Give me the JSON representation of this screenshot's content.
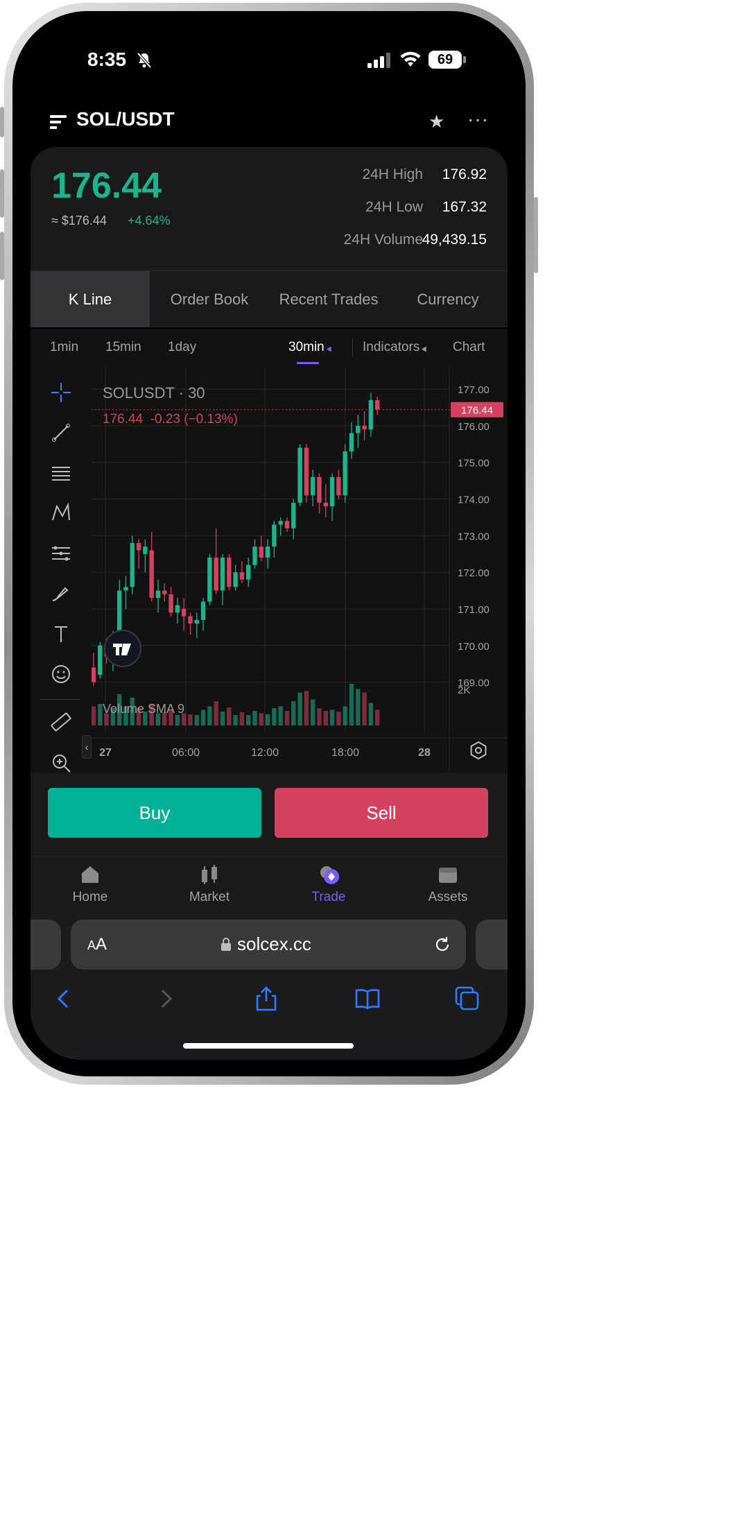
{
  "status_bar": {
    "time": "8:35",
    "battery": "69"
  },
  "header": {
    "pair": "SOL/USDT"
  },
  "ticker": {
    "last_price": "176.44",
    "usd_price": "≈ $176.44",
    "change_pct": "+4.64%",
    "stats": [
      {
        "label": "24H High",
        "value": "176.92"
      },
      {
        "label": "24H Low",
        "value": "167.32"
      },
      {
        "label": "24H Volume",
        "value": "49,439.15"
      }
    ]
  },
  "tabs": [
    "K Line",
    "Order Book",
    "Recent Trades",
    "Currency"
  ],
  "intervals": {
    "options": [
      "1min",
      "15min",
      "1day"
    ],
    "selected": "30min",
    "indicators": "Indicators",
    "chart": "Chart"
  },
  "chart_data": {
    "type": "candlestick",
    "symbol_label": "SOLUSDT · 30",
    "ohlc_label": "176.44  -0.23 (−0.13%)",
    "current_price_tag": "176.44",
    "y_ticks": [
      "177.00",
      "176.00",
      "175.00",
      "174.00",
      "173.00",
      "172.00",
      "171.00",
      "170.00",
      "169.00"
    ],
    "ylim": [
      168.5,
      177.4
    ],
    "x_ticks": [
      "27",
      "06:00",
      "12:00",
      "18:00",
      "28"
    ],
    "volume_label": "Volume SMA 9",
    "volume_tick": "2K",
    "candles": [
      {
        "o": 169.4,
        "h": 169.8,
        "l": 168.9,
        "c": 169.0
      },
      {
        "o": 169.2,
        "h": 170.1,
        "l": 169.1,
        "c": 170.0
      },
      {
        "o": 169.9,
        "h": 170.2,
        "l": 169.5,
        "c": 169.7
      },
      {
        "o": 169.7,
        "h": 170.4,
        "l": 169.3,
        "c": 170.2
      },
      {
        "o": 170.2,
        "h": 171.8,
        "l": 169.7,
        "c": 171.5
      },
      {
        "o": 171.5,
        "h": 171.9,
        "l": 171.0,
        "c": 171.6
      },
      {
        "o": 171.6,
        "h": 173.0,
        "l": 171.4,
        "c": 172.8
      },
      {
        "o": 172.8,
        "h": 172.9,
        "l": 172.1,
        "c": 172.6
      },
      {
        "o": 172.5,
        "h": 172.9,
        "l": 172.0,
        "c": 172.7
      },
      {
        "o": 172.6,
        "h": 173.1,
        "l": 171.2,
        "c": 171.3
      },
      {
        "o": 171.3,
        "h": 171.8,
        "l": 170.9,
        "c": 171.5
      },
      {
        "o": 171.5,
        "h": 171.7,
        "l": 171.2,
        "c": 171.4
      },
      {
        "o": 171.4,
        "h": 171.6,
        "l": 170.8,
        "c": 170.9
      },
      {
        "o": 170.9,
        "h": 171.3,
        "l": 170.6,
        "c": 171.1
      },
      {
        "o": 171.0,
        "h": 171.3,
        "l": 170.4,
        "c": 170.8
      },
      {
        "o": 170.8,
        "h": 170.9,
        "l": 170.3,
        "c": 170.6
      },
      {
        "o": 170.6,
        "h": 170.9,
        "l": 170.2,
        "c": 170.7
      },
      {
        "o": 170.7,
        "h": 171.3,
        "l": 170.4,
        "c": 171.2
      },
      {
        "o": 171.2,
        "h": 172.5,
        "l": 171.1,
        "c": 172.4
      },
      {
        "o": 172.4,
        "h": 173.2,
        "l": 171.4,
        "c": 171.5
      },
      {
        "o": 171.5,
        "h": 172.5,
        "l": 171.1,
        "c": 172.4
      },
      {
        "o": 172.4,
        "h": 172.5,
        "l": 171.5,
        "c": 171.6
      },
      {
        "o": 171.6,
        "h": 172.2,
        "l": 171.5,
        "c": 172.0
      },
      {
        "o": 172.0,
        "h": 172.3,
        "l": 171.7,
        "c": 171.8
      },
      {
        "o": 171.8,
        "h": 172.4,
        "l": 171.6,
        "c": 172.2
      },
      {
        "o": 172.2,
        "h": 172.9,
        "l": 172.1,
        "c": 172.7
      },
      {
        "o": 172.7,
        "h": 173.0,
        "l": 172.3,
        "c": 172.4
      },
      {
        "o": 172.4,
        "h": 172.9,
        "l": 172.1,
        "c": 172.7
      },
      {
        "o": 172.7,
        "h": 173.4,
        "l": 172.4,
        "c": 173.3
      },
      {
        "o": 173.3,
        "h": 173.5,
        "l": 173.0,
        "c": 173.4
      },
      {
        "o": 173.4,
        "h": 173.5,
        "l": 173.1,
        "c": 173.2
      },
      {
        "o": 173.2,
        "h": 174.0,
        "l": 172.9,
        "c": 173.9
      },
      {
        "o": 173.9,
        "h": 175.5,
        "l": 173.8,
        "c": 175.4
      },
      {
        "o": 175.4,
        "h": 175.5,
        "l": 173.9,
        "c": 174.1
      },
      {
        "o": 174.1,
        "h": 174.8,
        "l": 173.8,
        "c": 174.6
      },
      {
        "o": 174.6,
        "h": 174.7,
        "l": 173.6,
        "c": 173.9
      },
      {
        "o": 173.9,
        "h": 174.4,
        "l": 173.5,
        "c": 173.8
      },
      {
        "o": 173.8,
        "h": 174.7,
        "l": 173.4,
        "c": 174.6
      },
      {
        "o": 174.6,
        "h": 174.8,
        "l": 174.0,
        "c": 174.1
      },
      {
        "o": 174.1,
        "h": 175.5,
        "l": 173.9,
        "c": 175.3
      },
      {
        "o": 175.3,
        "h": 176.1,
        "l": 175.1,
        "c": 175.8
      },
      {
        "o": 175.8,
        "h": 176.3,
        "l": 175.4,
        "c": 176.0
      },
      {
        "o": 176.0,
        "h": 176.4,
        "l": 175.6,
        "c": 175.9
      },
      {
        "o": 175.9,
        "h": 176.9,
        "l": 175.7,
        "c": 176.7
      },
      {
        "o": 176.7,
        "h": 176.8,
        "l": 176.3,
        "c": 176.44
      }
    ],
    "volumes": [
      0.55,
      0.62,
      0.35,
      0.5,
      0.9,
      0.55,
      0.8,
      0.5,
      0.4,
      0.62,
      0.35,
      0.38,
      0.42,
      0.3,
      0.35,
      0.32,
      0.3,
      0.45,
      0.55,
      0.7,
      0.4,
      0.52,
      0.3,
      0.38,
      0.3,
      0.42,
      0.35,
      0.32,
      0.5,
      0.55,
      0.42,
      0.7,
      0.95,
      1.0,
      0.75,
      0.5,
      0.42,
      0.45,
      0.4,
      0.55,
      1.2,
      1.05,
      0.95,
      0.65,
      0.45
    ]
  },
  "actions": {
    "buy": "Buy",
    "sell": "Sell"
  },
  "bottom_nav": [
    {
      "label": "Home",
      "icon": "home-icon"
    },
    {
      "label": "Market",
      "icon": "market-icon"
    },
    {
      "label": "Trade",
      "icon": "trade-icon",
      "active": true
    },
    {
      "label": "Assets",
      "icon": "assets-icon"
    }
  ],
  "browser": {
    "text_size": "AA",
    "url": "solcex.cc"
  },
  "colors": {
    "up": "#1fb38d",
    "down": "#d3425e",
    "accent": "#7b5cff"
  }
}
